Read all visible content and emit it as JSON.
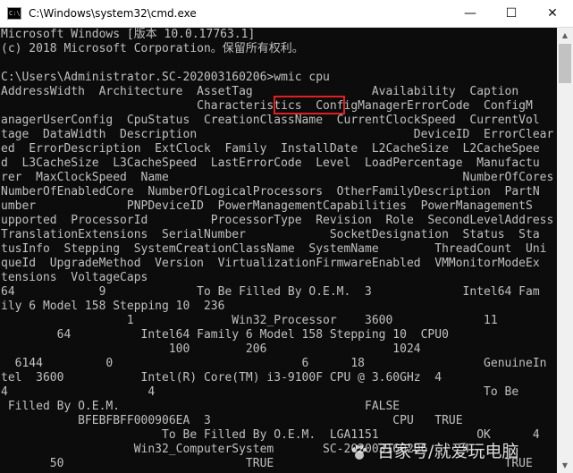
{
  "window": {
    "title": "C:\\Windows\\system32\\cmd.exe",
    "icon": "cmd-icon",
    "controls": {
      "minimize": "—",
      "maximize": "☐",
      "close": "✕"
    }
  },
  "console": {
    "lines": [
      "Microsoft Windows [版本 10.0.17763.1]",
      "(c) 2018 Microsoft Corporation。保留所有权利。",
      "",
      "C:\\Users\\Administrator.SC-202003160206>wmic cpu",
      "AddressWidth  Architecture  AssetTag                 Availability  Caption",
      "                            Characteristics  ConfigManagerErrorCode  ConfigM",
      "anagerUserConfig  CpuStatus  CreationClassName  CurrentClockSpeed  CurrentVol",
      "tage  DataWidth  Description                               DeviceID  ErrorClear",
      "ed  ErrorDescription  ExtClock  Family  InstallDate  L2CacheSize  L2CacheSpee",
      "d  L3CacheSize  L3CacheSpeed  LastErrorCode  Level  LoadPercentage  Manufactu",
      "rer  MaxClockSpeed  Name                                          NumberOfCores",
      "NumberOfEnabledCore  NumberOfLogicalProcessors  OtherFamilyDescription  PartN",
      "umber             PNPDeviceID  PowerManagementCapabilities  PowerManagementS",
      "upported  ProcessorId         ProcessorType  Revision  Role  SecondLevelAddress",
      "TranslationExtensions  SerialNumber            SocketDesignation  Status  Sta",
      "tusInfo  Stepping  SystemCreationClassName  SystemName        ThreadCount  Uni",
      "queId  UpgradeMethod  Version  VirtualizationFirmwareEnabled  VMMonitorModeEx",
      "tensions  VoltageCaps",
      "64            9             To Be Filled By O.E.M.  3             Intel64 Fam",
      "ily 6 Model 158 Stepping 10  236",
      "                  1              Win32_Processor    3600             11",
      "        64          Intel64 Family 6 Model 158 Stepping 10  CPU0",
      "                        100        206                  1024",
      "  6144         0                           6      18                 GenuineIn",
      "tel  3600           Intel(R) Core(TM) i3-9100F CPU @ 3.60GHz  4",
      "4                    4                                               To Be",
      " Filled By O.E.M.                                   FALSE",
      "           BFEBFBFF000906EA  3                          CPU   TRUE",
      "                       To Be Filled By O.E.M.  LGA1151              OK      4",
      "                   Win32_ComputerSystem       SC-202003160206     4",
      "       50                          TRUE                                 TRUE"
    ],
    "highlighted_command": "wmic cpu"
  },
  "watermark": {
    "text": "百家号/就爱玩电脑"
  },
  "colors": {
    "console_bg": "#0c0c0c",
    "console_fg": "#c0c0c0",
    "highlight_border": "#e02020",
    "titlebar_bg": "#ffffff"
  }
}
